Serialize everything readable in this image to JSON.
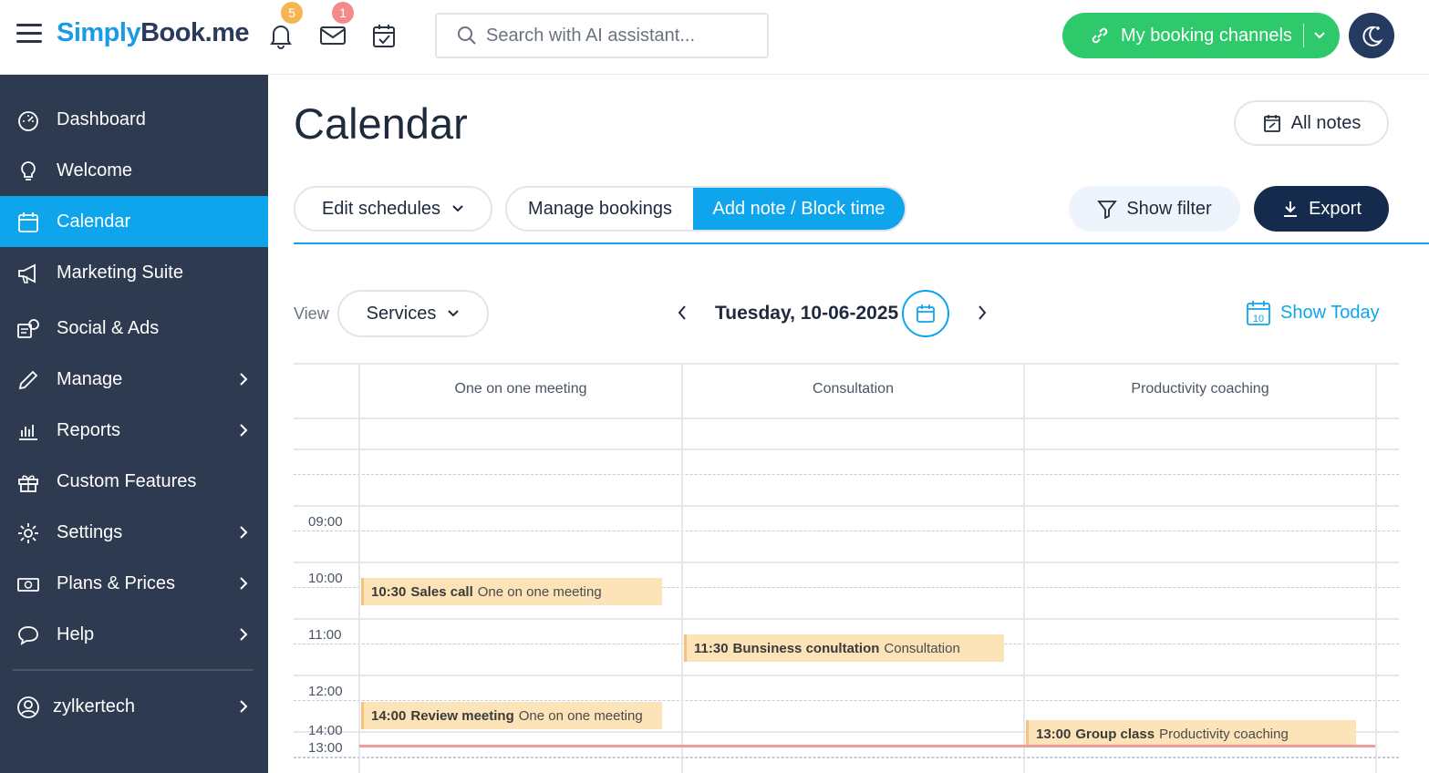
{
  "header": {
    "logo_part1": "S",
    "logo_part2": "imply",
    "logo_part3": "Book",
    "logo_part4": ".me",
    "notifications_count": "5",
    "messages_count": "1",
    "search_placeholder": "Search with AI assistant...",
    "booking_channels_label": "My booking channels"
  },
  "sidebar": {
    "items": [
      {
        "label": "Dashboard",
        "icon": "dashboard-icon"
      },
      {
        "label": "Welcome",
        "icon": "lightbulb-icon"
      },
      {
        "label": "Calendar",
        "icon": "calendar-icon",
        "active": true
      },
      {
        "label": "Marketing Suite",
        "icon": "megaphone-icon"
      },
      {
        "label": "Social & Ads",
        "icon": "social-ads-icon"
      },
      {
        "label": "Manage",
        "icon": "pencil-icon",
        "has_submenu": true
      },
      {
        "label": "Reports",
        "icon": "bar-chart-icon",
        "has_submenu": true
      },
      {
        "label": "Custom Features",
        "icon": "gift-icon"
      },
      {
        "label": "Settings",
        "icon": "gear-icon",
        "has_submenu": true
      },
      {
        "label": "Plans & Prices",
        "icon": "money-icon",
        "has_submenu": true
      },
      {
        "label": "Help",
        "icon": "chat-bubble-icon",
        "has_submenu": true
      }
    ],
    "user": {
      "label": "zylkertech",
      "icon": "user-icon"
    }
  },
  "main": {
    "title": "Calendar",
    "all_notes_label": "All notes",
    "edit_schedules_label": "Edit schedules",
    "manage_bookings_label": "Manage bookings",
    "add_note_label": "Add note / Block time",
    "show_filter_label": "Show filter",
    "export_label": "Export",
    "view_label": "View",
    "view_value": "Services",
    "date_label": "Tuesday, 10-06-2025",
    "show_today_label": "Show Today",
    "today_icon_number": "10"
  },
  "calendar": {
    "columns": [
      "One on one meeting",
      "Consultation",
      "Productivity coaching"
    ],
    "times": [
      "09:00",
      "10:00",
      "11:00",
      "12:00",
      "13:00",
      "14:00"
    ],
    "events": [
      {
        "time": "10:30",
        "title": "Sales call",
        "service": "One on one meeting"
      },
      {
        "time": "11:30",
        "title": "Bunsiness conultation",
        "service": "Consultation"
      },
      {
        "time": "13:00",
        "title": "Group class",
        "service": "Productivity coaching"
      },
      {
        "time": "14:00",
        "title": "Review meeting",
        "service": "One on one meeting"
      }
    ]
  },
  "colors": {
    "accent": "#0ea5ed",
    "sidebar_bg": "#2d3a50",
    "channels_green": "#2dc96b",
    "export_navy": "#142b4d",
    "event_bg": "#fde3b8",
    "now_line": "#f29b9b"
  }
}
